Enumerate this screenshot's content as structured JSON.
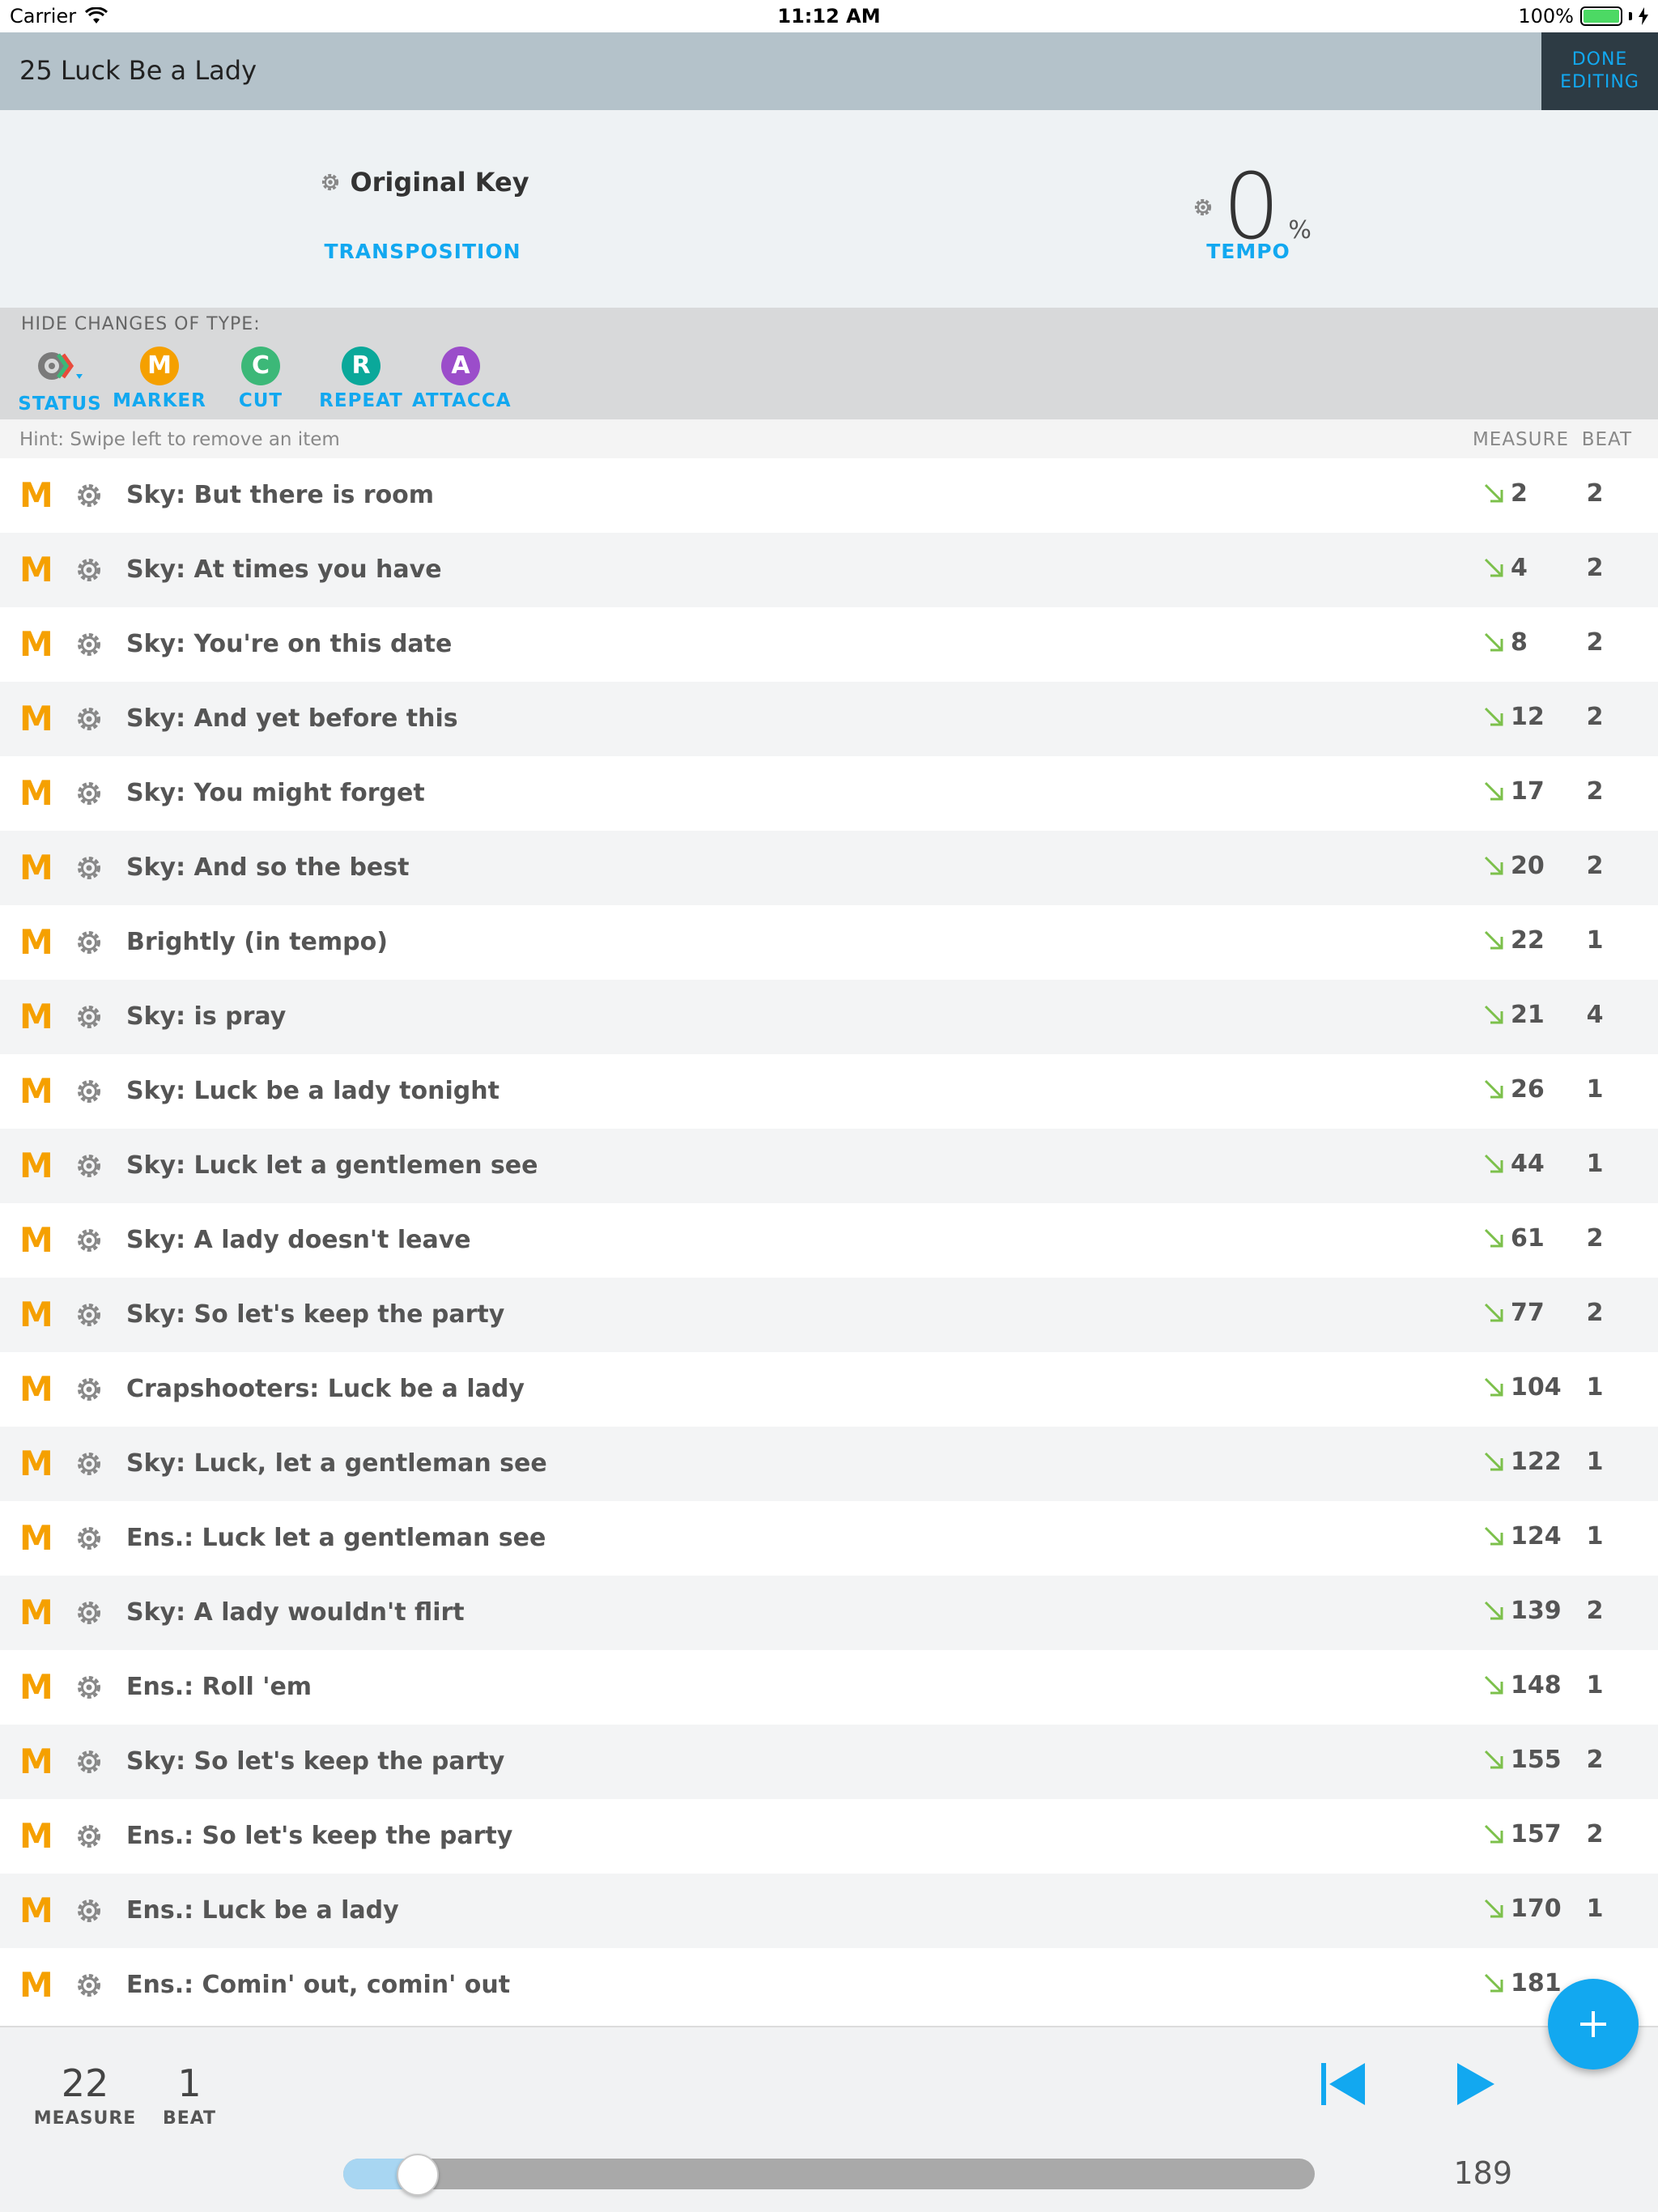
{
  "status_bar": {
    "carrier": "Carrier",
    "time": "11:12 AM",
    "battery": "100%"
  },
  "header": {
    "title": "25 Luck Be a Lady",
    "done_line1": "DONE",
    "done_line2": "EDITING"
  },
  "transposition": {
    "value": "Original Key",
    "label": "TRANSPOSITION"
  },
  "tempo": {
    "value": "0",
    "unit": "%",
    "label": "TEMPO"
  },
  "filters": {
    "title": "HIDE CHANGES OF TYPE:",
    "items": [
      {
        "letter": "",
        "label": "STATUS",
        "color": "#808080"
      },
      {
        "letter": "M",
        "label": "MARKER",
        "color": "#f5a000"
      },
      {
        "letter": "C",
        "label": "CUT",
        "color": "#3cb878"
      },
      {
        "letter": "R",
        "label": "REPEAT",
        "color": "#0aa89a"
      },
      {
        "letter": "A",
        "label": "ATTACCA",
        "color": "#9b4dca"
      }
    ]
  },
  "hint": {
    "text": "Hint: Swipe left to remove an item",
    "col_measure": "MEASURE",
    "col_beat": "BEAT"
  },
  "rows": [
    {
      "type": "M",
      "name": "Sky: But there is room",
      "measure": "2",
      "beat": "2"
    },
    {
      "type": "M",
      "name": "Sky: At times you have",
      "measure": "4",
      "beat": "2"
    },
    {
      "type": "M",
      "name": "Sky: You're on this date",
      "measure": "8",
      "beat": "2"
    },
    {
      "type": "M",
      "name": "Sky: And yet before this",
      "measure": "12",
      "beat": "2"
    },
    {
      "type": "M",
      "name": "Sky: You might forget",
      "measure": "17",
      "beat": "2"
    },
    {
      "type": "M",
      "name": "Sky: And so the best",
      "measure": "20",
      "beat": "2"
    },
    {
      "type": "M",
      "name": "Brightly (in tempo)",
      "measure": "22",
      "beat": "1"
    },
    {
      "type": "M",
      "name": "Sky: is pray",
      "measure": "21",
      "beat": "4"
    },
    {
      "type": "M",
      "name": "Sky: Luck be a lady tonight",
      "measure": "26",
      "beat": "1"
    },
    {
      "type": "M",
      "name": "Sky: Luck let a gentlemen see",
      "measure": "44",
      "beat": "1"
    },
    {
      "type": "M",
      "name": "Sky: A lady doesn't leave",
      "measure": "61",
      "beat": "2"
    },
    {
      "type": "M",
      "name": "Sky: So let's keep the party",
      "measure": "77",
      "beat": "2"
    },
    {
      "type": "M",
      "name": "Crapshooters: Luck be a lady",
      "measure": "104",
      "beat": "1"
    },
    {
      "type": "M",
      "name": "Sky: Luck, let a gentleman see",
      "measure": "122",
      "beat": "1"
    },
    {
      "type": "M",
      "name": "Ens.: Luck let a gentleman see",
      "measure": "124",
      "beat": "1"
    },
    {
      "type": "M",
      "name": "Sky: A lady wouldn't flirt",
      "measure": "139",
      "beat": "2"
    },
    {
      "type": "M",
      "name": "Ens.: Roll 'em",
      "measure": "148",
      "beat": "1"
    },
    {
      "type": "M",
      "name": "Sky: So let's keep the party",
      "measure": "155",
      "beat": "2"
    },
    {
      "type": "M",
      "name": "Ens.: So let's keep the party",
      "measure": "157",
      "beat": "2"
    },
    {
      "type": "M",
      "name": "Ens.: Luck be a lady",
      "measure": "170",
      "beat": "1"
    },
    {
      "type": "M",
      "name": "Ens.: Comin' out, comin' out",
      "measure": "181",
      "beat": ""
    }
  ],
  "footer": {
    "measure_value": "22",
    "measure_label": "MEASURE",
    "beat_value": "1",
    "beat_label": "BEAT",
    "total_measures": "189",
    "progress_fraction": 0.077
  },
  "colors": {
    "accent": "#12a8f0",
    "marker": "#f5a000",
    "arrow": "#7cc04b"
  },
  "icons": [
    "wifi-icon",
    "battery-icon",
    "gear-icon",
    "arrow-down-right-icon",
    "skip-back-icon",
    "play-icon",
    "plus-icon"
  ]
}
